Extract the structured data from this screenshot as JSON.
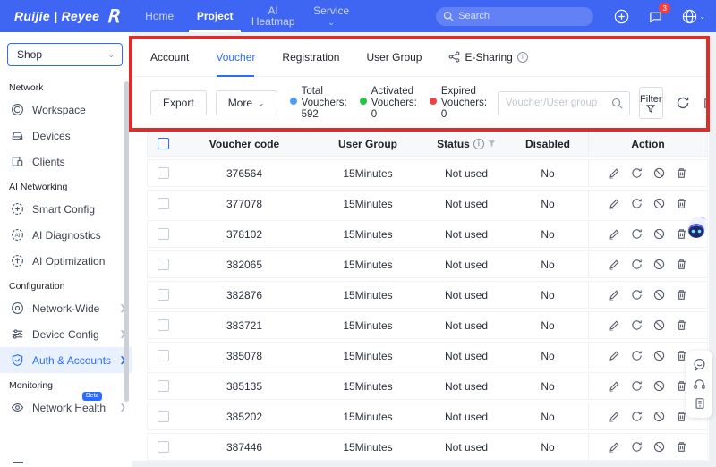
{
  "topbar": {
    "logo_text": "Ruijie | Reyee",
    "nav": [
      {
        "label": "Home"
      },
      {
        "label": "Project"
      },
      {
        "label": "AI Heatmap"
      },
      {
        "label": "Service"
      }
    ],
    "active_nav": "Project",
    "search_placeholder": "Search",
    "notification_badge": "3"
  },
  "sidebar": {
    "project_selector_value": "Shop",
    "sections": [
      {
        "label": "Network",
        "items": [
          {
            "label": "Workspace"
          },
          {
            "label": "Devices"
          },
          {
            "label": "Clients"
          }
        ]
      },
      {
        "label": "AI Networking",
        "items": [
          {
            "label": "Smart Config"
          },
          {
            "label": "AI Diagnostics"
          },
          {
            "label": "AI Optimization"
          }
        ]
      },
      {
        "label": "Configuration",
        "items": [
          {
            "label": "Network-Wide"
          },
          {
            "label": "Device Config"
          },
          {
            "label": "Auth & Accounts",
            "active": true
          }
        ]
      },
      {
        "label": "Monitoring",
        "items": [
          {
            "label": "Network Health",
            "badge": "Beta"
          }
        ]
      }
    ]
  },
  "tabs": {
    "items": [
      {
        "label": "Account"
      },
      {
        "label": "Voucher",
        "active": true
      },
      {
        "label": "Registration"
      },
      {
        "label": "User Group"
      },
      {
        "label": "E-Sharing"
      }
    ]
  },
  "toolbar": {
    "export_label": "Export",
    "more_label": "More",
    "stats": [
      {
        "line1": "Total",
        "line2": "Vouchers:",
        "value": "592",
        "dot_color": "#4a9eff"
      },
      {
        "line1": "Activated",
        "line2": "Vouchers:",
        "value": "0",
        "dot_color": "#23c343"
      },
      {
        "line1": "Expired",
        "line2": "Vouchers:",
        "value": "0",
        "dot_color": "#f53f3f"
      }
    ],
    "search_placeholder": "Voucher/User group",
    "filter_label": "Filter"
  },
  "table": {
    "columns": [
      "Voucher code",
      "User Group",
      "Status",
      "Disabled",
      "Action"
    ],
    "rows": [
      {
        "code": "376564",
        "group": "15Minutes",
        "status": "Not used",
        "disabled": "No"
      },
      {
        "code": "377078",
        "group": "15Minutes",
        "status": "Not used",
        "disabled": "No"
      },
      {
        "code": "378102",
        "group": "15Minutes",
        "status": "Not used",
        "disabled": "No"
      },
      {
        "code": "382065",
        "group": "15Minutes",
        "status": "Not used",
        "disabled": "No"
      },
      {
        "code": "382876",
        "group": "15Minutes",
        "status": "Not used",
        "disabled": "No"
      },
      {
        "code": "383721",
        "group": "15Minutes",
        "status": "Not used",
        "disabled": "No"
      },
      {
        "code": "385078",
        "group": "15Minutes",
        "status": "Not used",
        "disabled": "No"
      },
      {
        "code": "385135",
        "group": "15Minutes",
        "status": "Not used",
        "disabled": "No"
      },
      {
        "code": "385202",
        "group": "15Minutes",
        "status": "Not used",
        "disabled": "No"
      },
      {
        "code": "387446",
        "group": "15Minutes",
        "status": "Not used",
        "disabled": "No"
      }
    ]
  },
  "colors": {
    "topbar_blue": "#3f66f2",
    "accent_blue": "#2b6cff",
    "annotation_red": "#e12b2b",
    "dot_blue": "#4a9eff",
    "dot_green": "#23c343",
    "dot_red": "#f53f3f"
  }
}
